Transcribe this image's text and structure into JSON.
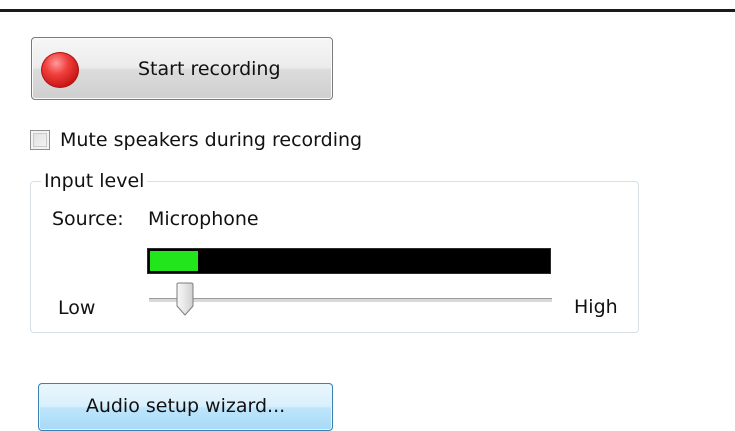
{
  "recording": {
    "start_label": "Start recording",
    "icon": "record-icon",
    "icon_color": "#e02a28"
  },
  "options": {
    "mute_label": "Mute speakers during recording",
    "mute_checked": false
  },
  "input_level": {
    "group_label": "Input level",
    "source_label": "Source:",
    "source_value": "Microphone",
    "meter_level": 0.12,
    "meter_color": "#22e51b",
    "slider_low_label": "Low",
    "slider_high_label": "High",
    "slider_value": 0.09
  },
  "wizard": {
    "label": "Audio setup wizard..."
  }
}
